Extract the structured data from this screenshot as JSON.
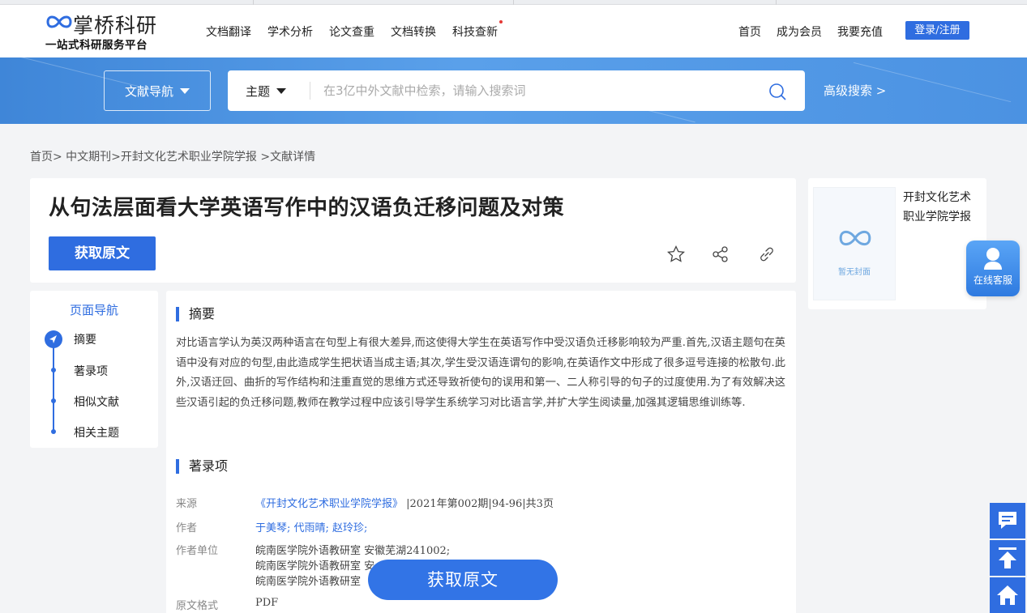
{
  "header": {
    "logo_name": "掌桥科研",
    "logo_sub": "一站式科研服务平台",
    "nav": [
      "文档翻译",
      "学术分析",
      "论文查重",
      "文档转换",
      "科技查新"
    ],
    "right_nav": [
      "首页",
      "成为会员",
      "我要充值"
    ],
    "login": "登录/注册"
  },
  "search": {
    "nav_dropdown": "文献导航",
    "type": "主题",
    "placeholder": "在3亿中外文献中检索，请输入搜索词",
    "advanced": "高级搜索 >"
  },
  "breadcrumb": "首页> 中文期刊>开封文化艺术职业学院学报 >文献详情",
  "article": {
    "title": "从句法层面看大学英语写作中的汉语负迁移问题及对策",
    "get_button": "获取原文"
  },
  "journal": {
    "name": "开封文化艺术职业学院学报",
    "cover_text": "暂无封面"
  },
  "service_label": "在线客服",
  "page_nav": {
    "title": "页面导航",
    "items": [
      "摘要",
      "著录项",
      "相似文献",
      "相关主题"
    ]
  },
  "abstract": {
    "heading": "摘要",
    "text": "对比语言学认为英汉两种语言在句型上有很大差异,而这使得大学生在英语写作中受汉语负迁移影响较为严重.首先,汉语主题句在英语中没有对应的句型,由此造成学生把状语当成主语;其次,学生受汉语连谓句的影响,在英语作文中形成了很多逗号连接的松散句.此外,汉语迂回、曲折的写作结构和注重直觉的思维方式还导致祈使句的误用和第一、二人称引导的句子的过度使用.为了有效解决这些汉语引起的负迁移问题,教师在教学过程中应该引导学生系统学习对比语言学,并扩大学生阅读量,加强其逻辑思维训练等."
  },
  "record": {
    "heading": "著录项",
    "source_label": "来源",
    "source_link": "《开封文化艺术职业学院学报》",
    "source_rest": "|2021年第002期|94-96|共3页",
    "author_label": "作者",
    "authors": "于美琴; 代雨晴; 赵玲珍;",
    "unit_label": "作者单位",
    "units": [
      "皖南医学院外语教研室 安徽芜湖241002;",
      "皖南医学院外语教研室 安",
      "皖南医学院外语教研室"
    ],
    "format_label": "原文格式",
    "format": "PDF"
  },
  "float_button": "获取原文",
  "colors": {
    "accent": "#2f6de0",
    "banner": "#4b92e2"
  }
}
